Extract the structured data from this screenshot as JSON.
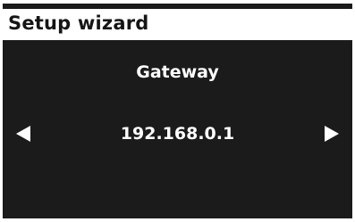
{
  "screen": {
    "title": "Setup wizard"
  },
  "setting": {
    "label": "Gateway",
    "value": "192.168.0.1"
  },
  "icons": {
    "left": "triangle-left-icon",
    "right": "triangle-right-icon"
  },
  "colors": {
    "display_background": "#1b1b1b",
    "foreground": "#ffffff",
    "title_text": "#151515"
  }
}
